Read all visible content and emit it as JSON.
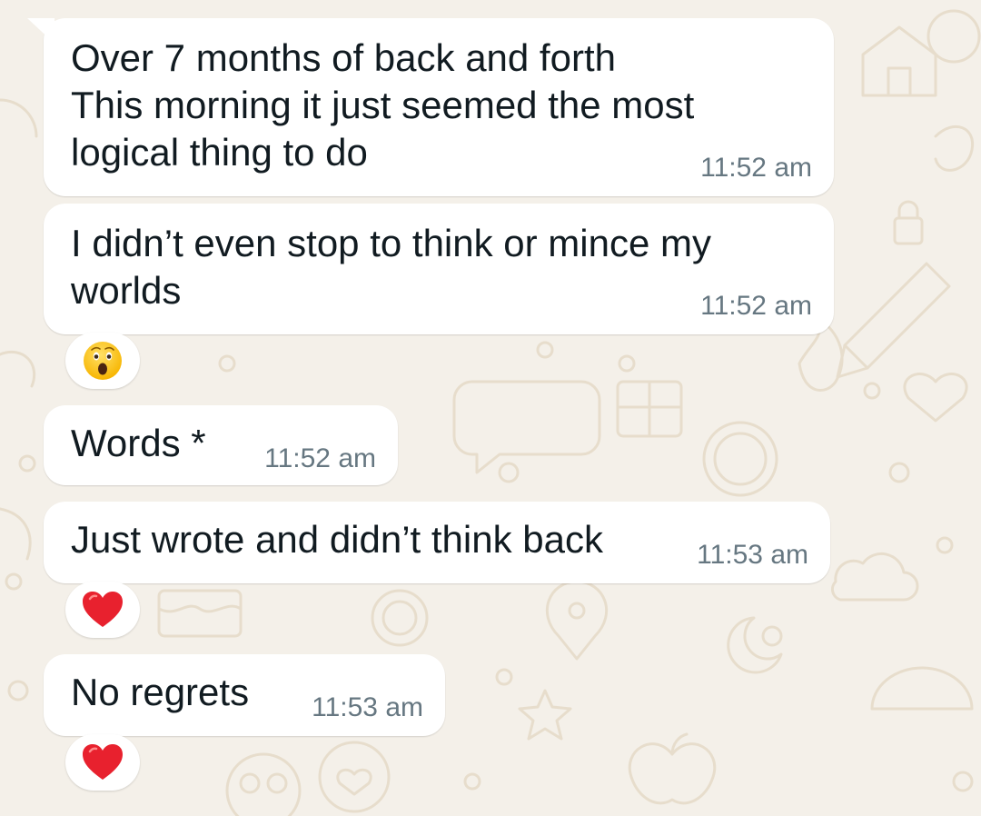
{
  "colors": {
    "background": "#f4f0e9",
    "bubble": "#ffffff",
    "text": "#111b21",
    "timestamp": "#667781",
    "doodle": "#e7ddcc"
  },
  "messages": [
    {
      "lines": [
        "Over 7 months of back and forth",
        "This morning it just seemed the most",
        "logical thing to do"
      ],
      "time": "11:52 am",
      "reaction": null
    },
    {
      "lines": [
        "I didn’t even stop to think or mince my",
        "worlds"
      ],
      "time": "11:52 am",
      "reaction": "astonished-face-icon"
    },
    {
      "lines": [
        "Words *"
      ],
      "time": "11:52 am",
      "reaction": null
    },
    {
      "lines": [
        "Just wrote and didn’t think back"
      ],
      "time": "11:53 am",
      "reaction": "red-heart-icon"
    },
    {
      "lines": [
        "No regrets"
      ],
      "time": "11:53 am",
      "reaction": "red-heart-icon"
    }
  ]
}
